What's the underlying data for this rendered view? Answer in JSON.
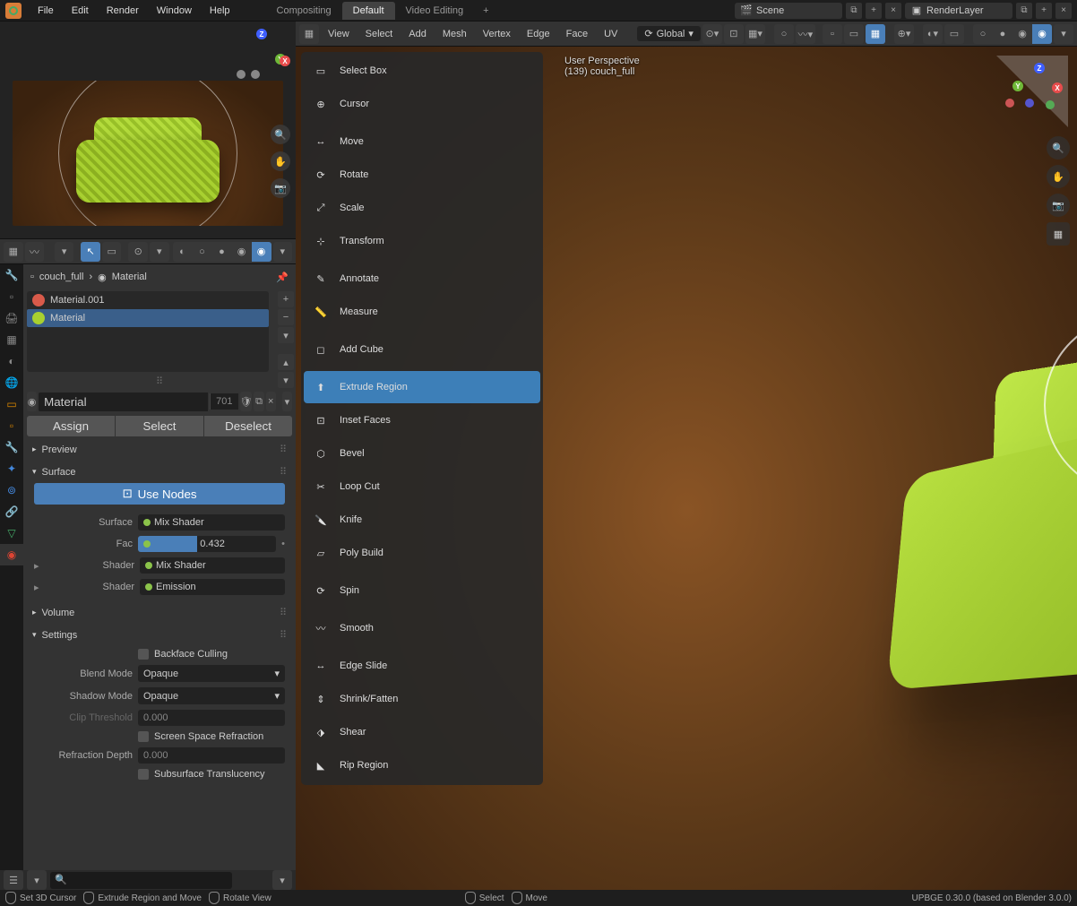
{
  "menu": {
    "file": "File",
    "edit": "Edit",
    "render": "Render",
    "window": "Window",
    "help": "Help"
  },
  "workspaces": {
    "compositing": "Compositing",
    "default": "Default",
    "video": "Video Editing"
  },
  "scene_field": "Scene",
  "layer_field": "RenderLayer",
  "viewport_menus": {
    "view": "View",
    "select": "Select",
    "add": "Add",
    "mesh": "Mesh",
    "vertex": "Vertex",
    "edge": "Edge",
    "face": "Face",
    "uv": "UV"
  },
  "orientation": "Global",
  "viewport_info": {
    "line1": "User Perspective",
    "line2": "(139) couch_full"
  },
  "tools": [
    {
      "label": "Select Box",
      "group_end": false
    },
    {
      "label": "Cursor",
      "group_end": true
    },
    {
      "label": "Move",
      "group_end": false
    },
    {
      "label": "Rotate",
      "group_end": false
    },
    {
      "label": "Scale",
      "group_end": false
    },
    {
      "label": "Transform",
      "group_end": true
    },
    {
      "label": "Annotate",
      "group_end": false
    },
    {
      "label": "Measure",
      "group_end": true
    },
    {
      "label": "Add Cube",
      "group_end": true
    },
    {
      "label": "Extrude Region",
      "active": true,
      "group_end": false
    },
    {
      "label": "Inset Faces",
      "group_end": false
    },
    {
      "label": "Bevel",
      "group_end": false
    },
    {
      "label": "Loop Cut",
      "group_end": false
    },
    {
      "label": "Knife",
      "group_end": false
    },
    {
      "label": "Poly Build",
      "group_end": true
    },
    {
      "label": "Spin",
      "group_end": true
    },
    {
      "label": "Smooth",
      "group_end": true
    },
    {
      "label": "Edge Slide",
      "group_end": false
    },
    {
      "label": "Shrink/Fatten",
      "group_end": false
    },
    {
      "label": "Shear",
      "group_end": false
    },
    {
      "label": "Rip Region",
      "group_end": false
    }
  ],
  "breadcrumb": {
    "obj": "couch_full",
    "mat": "Material"
  },
  "materials": [
    {
      "name": "Material.001",
      "color": "#d85a4a"
    },
    {
      "name": "Material",
      "color": "#a8d030",
      "selected": true
    }
  ],
  "mat_name": "Material",
  "mat_users": "701",
  "buttons": {
    "assign": "Assign",
    "select": "Select",
    "deselect": "Deselect"
  },
  "sections": {
    "preview": "Preview",
    "surface": "Surface",
    "volume": "Volume",
    "settings": "Settings"
  },
  "use_nodes": "Use Nodes",
  "props": {
    "surface_label": "Surface",
    "surface_value": "Mix Shader",
    "fac_label": "Fac",
    "fac_value": "0.432",
    "shader1_label": "Shader",
    "shader1_value": "Mix Shader",
    "shader2_label": "Shader",
    "shader2_value": "Emission"
  },
  "settings": {
    "backface": "Backface Culling",
    "blend_label": "Blend Mode",
    "blend_value": "Opaque",
    "shadow_label": "Shadow Mode",
    "shadow_value": "Opaque",
    "clip_label": "Clip Threshold",
    "clip_value": "0.000",
    "ssr": "Screen Space Refraction",
    "refr_label": "Refraction Depth",
    "refr_value": "0.000",
    "sss": "Subsurface Translucency"
  },
  "status": {
    "s1": "Set 3D Cursor",
    "s2": "Extrude Region and Move",
    "s3": "Rotate View",
    "s4": "Select",
    "s5": "Move",
    "version": "UPBGE 0.30.0 (based on Blender 3.0.0)"
  },
  "search_placeholder": ""
}
